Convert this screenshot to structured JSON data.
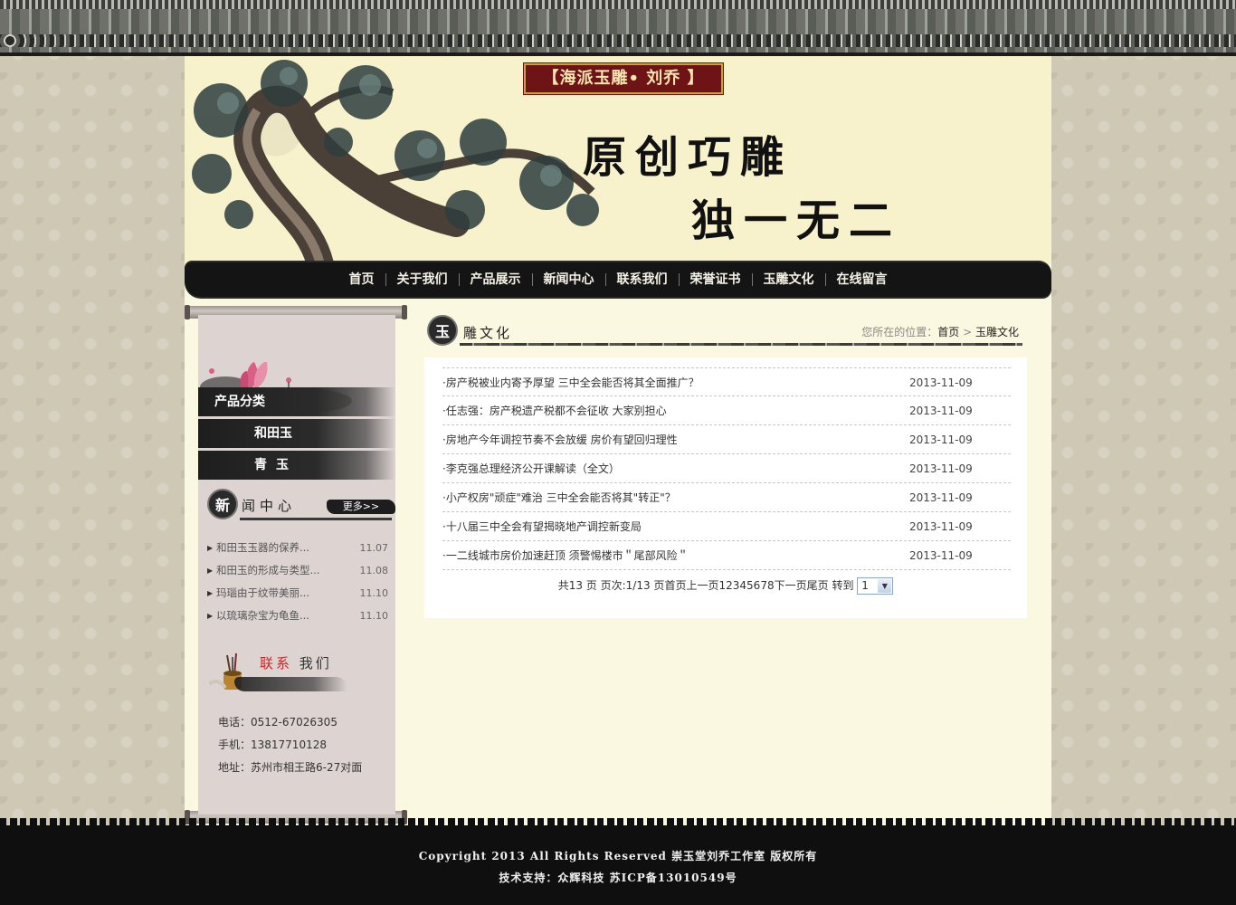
{
  "header": {
    "seal": "【海派玉雕• 刘乔 】",
    "slogan_line1": "原创巧雕",
    "slogan_line2": "独一无二"
  },
  "nav": {
    "items": [
      "首页",
      "关于我们",
      "产品展示",
      "新闻中心",
      "联系我们",
      "荣誉证书",
      "玉雕文化",
      "在线留言"
    ]
  },
  "sidebar": {
    "category_title": "产品分类",
    "categories": [
      "和田玉",
      "青玉"
    ],
    "news": {
      "badge": "新",
      "title": "闻中心",
      "more": "更多>>",
      "items": [
        {
          "title": "和田玉玉器的保养...",
          "date": "11.07"
        },
        {
          "title": "和田玉的形成与类型...",
          "date": "11.08"
        },
        {
          "title": "玛瑙由于纹带美丽...",
          "date": "11.10"
        },
        {
          "title": "以琉璃杂宝为龟鱼...",
          "date": "11.10"
        }
      ]
    },
    "contact": {
      "title_red": "联系",
      "title_rest": "我们",
      "phone": "电话：0512-67026305",
      "mobile": "手机：13817710128",
      "address": "地址：苏州市相王路6-27对面"
    }
  },
  "main": {
    "badge": "玉",
    "title": "雕文化",
    "crumb_prefix": "您所在的位置：",
    "crumb_home": "首页",
    "crumb_sep": " > ",
    "crumb_current": "玉雕文化",
    "articles": [
      {
        "title": "·房产税被业内寄予厚望 三中全会能否将其全面推广？",
        "date": "2013-11-09"
      },
      {
        "title": "·任志强：房产税遗产税都不会征收 大家别担心",
        "date": "2013-11-09"
      },
      {
        "title": "·房地产今年调控节奏不会放缓 房价有望回归理性",
        "date": "2013-11-09"
      },
      {
        "title": "·李克强总理经济公开课解读（全文）",
        "date": "2013-11-09"
      },
      {
        "title": "·小产权房\"顽症\"难治 三中全会能否将其\"转正\"？",
        "date": "2013-11-09"
      },
      {
        "title": "·十八届三中全会有望揭晓地产调控新变局",
        "date": "2013-11-09"
      },
      {
        "title": "·一二线城市房价加速赶顶 须警惕楼市＂尾部风险＂",
        "date": "2013-11-09"
      }
    ],
    "pager": {
      "summary": "共13 页 页次:1/13 页",
      "first": "首页",
      "prev": "上一页",
      "pages": [
        "1",
        "2",
        "3",
        "4",
        "5",
        "6",
        "7",
        "8"
      ],
      "next": "下一页",
      "last": "尾页",
      "goto_label": " 转到 ",
      "goto_value": "1"
    }
  },
  "footer": {
    "line1": "Copyright 2013 All Rights Reserved 崇玉堂刘乔工作室 版权所有",
    "line2": "技术支持：众辉科技   苏ICP备13010549号"
  }
}
